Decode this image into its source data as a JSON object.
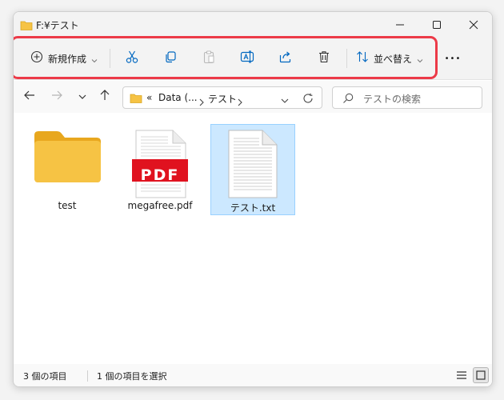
{
  "window": {
    "title": "F:¥テスト"
  },
  "toolbar": {
    "new_label": "新規作成",
    "sort_label": "並べ替え",
    "more_label": "•••"
  },
  "nav": {
    "breadcrumb_prefix": "«",
    "breadcrumb_1": "Data (...",
    "breadcrumb_2": "テスト",
    "search_placeholder": "テストの検索"
  },
  "files": [
    {
      "name": "test",
      "icon": "folder-icon"
    },
    {
      "name": "megafree.pdf",
      "icon": "pdf-file-icon",
      "badge": "PDF"
    },
    {
      "name": "テスト.txt",
      "icon": "text-file-icon",
      "selected": true
    }
  ],
  "status": {
    "item_count": "3 個の項目",
    "selection": "1 個の項目を選択"
  },
  "colors": {
    "accent": "#0067c0",
    "highlight_border": "#ec3a48",
    "folder": "#f6c344",
    "pdf_red": "#e0121f",
    "selection": "#cce8ff"
  }
}
